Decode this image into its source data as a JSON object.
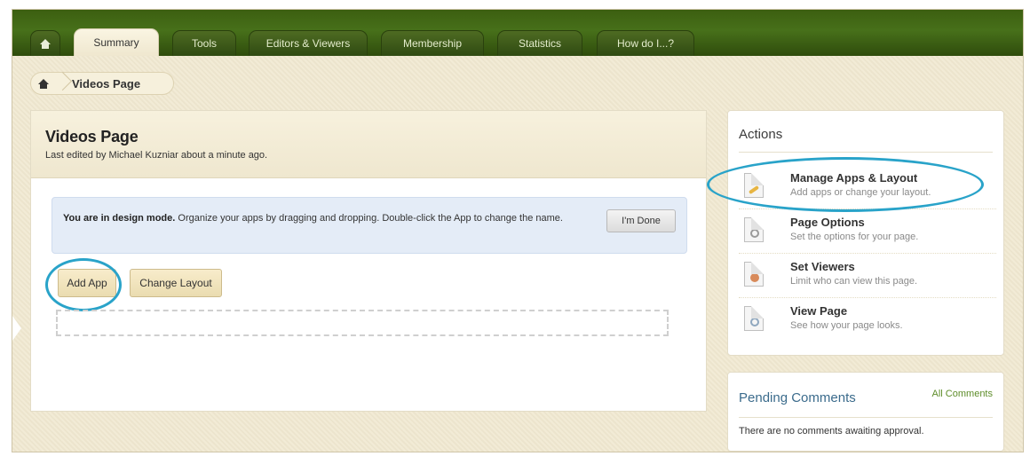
{
  "topnav": {
    "tabs": [
      {
        "label": "",
        "icon": "home-icon"
      },
      {
        "label": "Summary",
        "active": true
      },
      {
        "label": "Tools"
      },
      {
        "label": "Editors & Viewers"
      },
      {
        "label": "Membership"
      },
      {
        "label": "Statistics"
      },
      {
        "label": "How do I...?"
      }
    ]
  },
  "breadcrumb": {
    "home_icon": "home-icon",
    "current": "Videos Page"
  },
  "page": {
    "title": "Videos Page",
    "last_edited": "Last edited by Michael Kuzniar about a minute ago."
  },
  "design_mode": {
    "bold_text": "You are in design mode.",
    "text": " Organize your apps by dragging and dropping. Double-click the App to change the name.",
    "done_label": "I'm Done"
  },
  "toolbar": {
    "add_app_label": "Add App",
    "change_layout_label": "Change Layout"
  },
  "actions": {
    "title": "Actions",
    "items": [
      {
        "label": "Manage Apps & Layout",
        "desc": "Add apps or change your layout.",
        "icon": "pencil-icon"
      },
      {
        "label": "Page Options",
        "desc": "Set the options for your page.",
        "icon": "gear-icon"
      },
      {
        "label": "Set Viewers",
        "desc": "Limit who can view this page.",
        "icon": "users-icon"
      },
      {
        "label": "View Page",
        "desc": "See how your page looks.",
        "icon": "magnifier-icon"
      }
    ]
  },
  "pending_comments": {
    "title": "Pending Comments",
    "all_link": "All Comments",
    "empty_text": "There are no comments awaiting approval."
  },
  "colors": {
    "nav_green": "#3c5f10",
    "highlight_ring": "#29a3c9",
    "link_green": "#5e8d2a",
    "design_box_bg": "#e4ecf7"
  }
}
